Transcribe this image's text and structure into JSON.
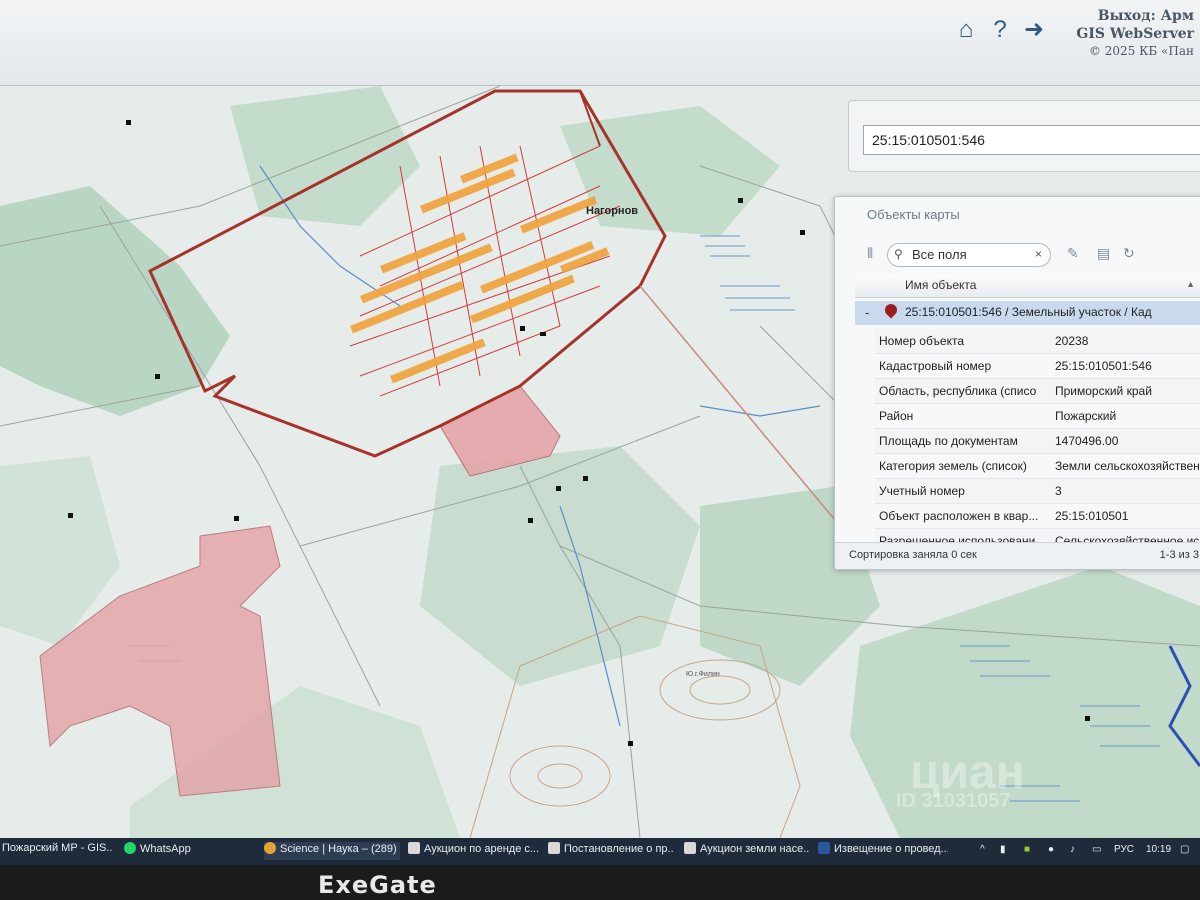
{
  "header": {
    "exit_label": "Выход: Арм",
    "server_label": "GIS WebServer",
    "copyright": "© 2025 КБ «Пан",
    "icons": [
      "home-icon",
      "help-icon",
      "logout-icon"
    ]
  },
  "map": {
    "place_label": "Нагорнов",
    "legend_labels": [
      "Ю.г.Филин"
    ]
  },
  "search": {
    "value": "25:15:010501:546"
  },
  "panel": {
    "title": "Объекты карты",
    "filter_placeholder": "Все поля",
    "column_header": "Имя объекта",
    "object_row": "25:15:010501:546 / Земельный участок / Кад",
    "attributes": [
      {
        "key": "Номер объекта",
        "value": "20238"
      },
      {
        "key": "Кадастровый номер",
        "value": "25:15:010501:546"
      },
      {
        "key": "Область, республика (списо",
        "value": "Приморский край"
      },
      {
        "key": "Район",
        "value": "Пожарский"
      },
      {
        "key": "Площадь по документам",
        "value": "1470496.00"
      },
      {
        "key": "Категория земель (список)",
        "value": "Земли сельскохозяйственн"
      },
      {
        "key": "Учетный номер",
        "value": "3"
      },
      {
        "key": "Объект расположен в квар...",
        "value": "25:15:010501"
      },
      {
        "key": "Разрешенное использовани",
        "value": "Сельскохозяйственное исп"
      }
    ],
    "footer_left": "Сортировка заняла 0 сек",
    "footer_right": "1-3 из 3"
  },
  "taskbar": {
    "items": [
      {
        "label": "Пожарский МР - GIS...",
        "color": "#3a78c4"
      },
      {
        "label": "WhatsApp",
        "color": "#25d366"
      },
      {
        "label": "Science | Наука – (289)",
        "color": "#e3a33a"
      },
      {
        "label": "Аукцион по аренде с...",
        "color": "#d8d8d8"
      },
      {
        "label": "Постановление о пр...",
        "color": "#d8d8d8"
      },
      {
        "label": "Аукцион земли насе...",
        "color": "#d8d8d8"
      },
      {
        "label": "Извещение о провед...",
        "color": "#2b579a"
      }
    ],
    "lang": "РУС",
    "time": "10:19"
  },
  "monitor": {
    "brand": "ExeGate"
  },
  "overlay": {
    "watermark": "циан",
    "watermark_id": "ID 31031057"
  },
  "colors": {
    "parcel_outline": "#a8322a",
    "building_fill": "#f0a23a",
    "highlight_parcel": "#e4a6a8",
    "selection_row": "#c9d9ee",
    "header_text": "#4b5663"
  }
}
